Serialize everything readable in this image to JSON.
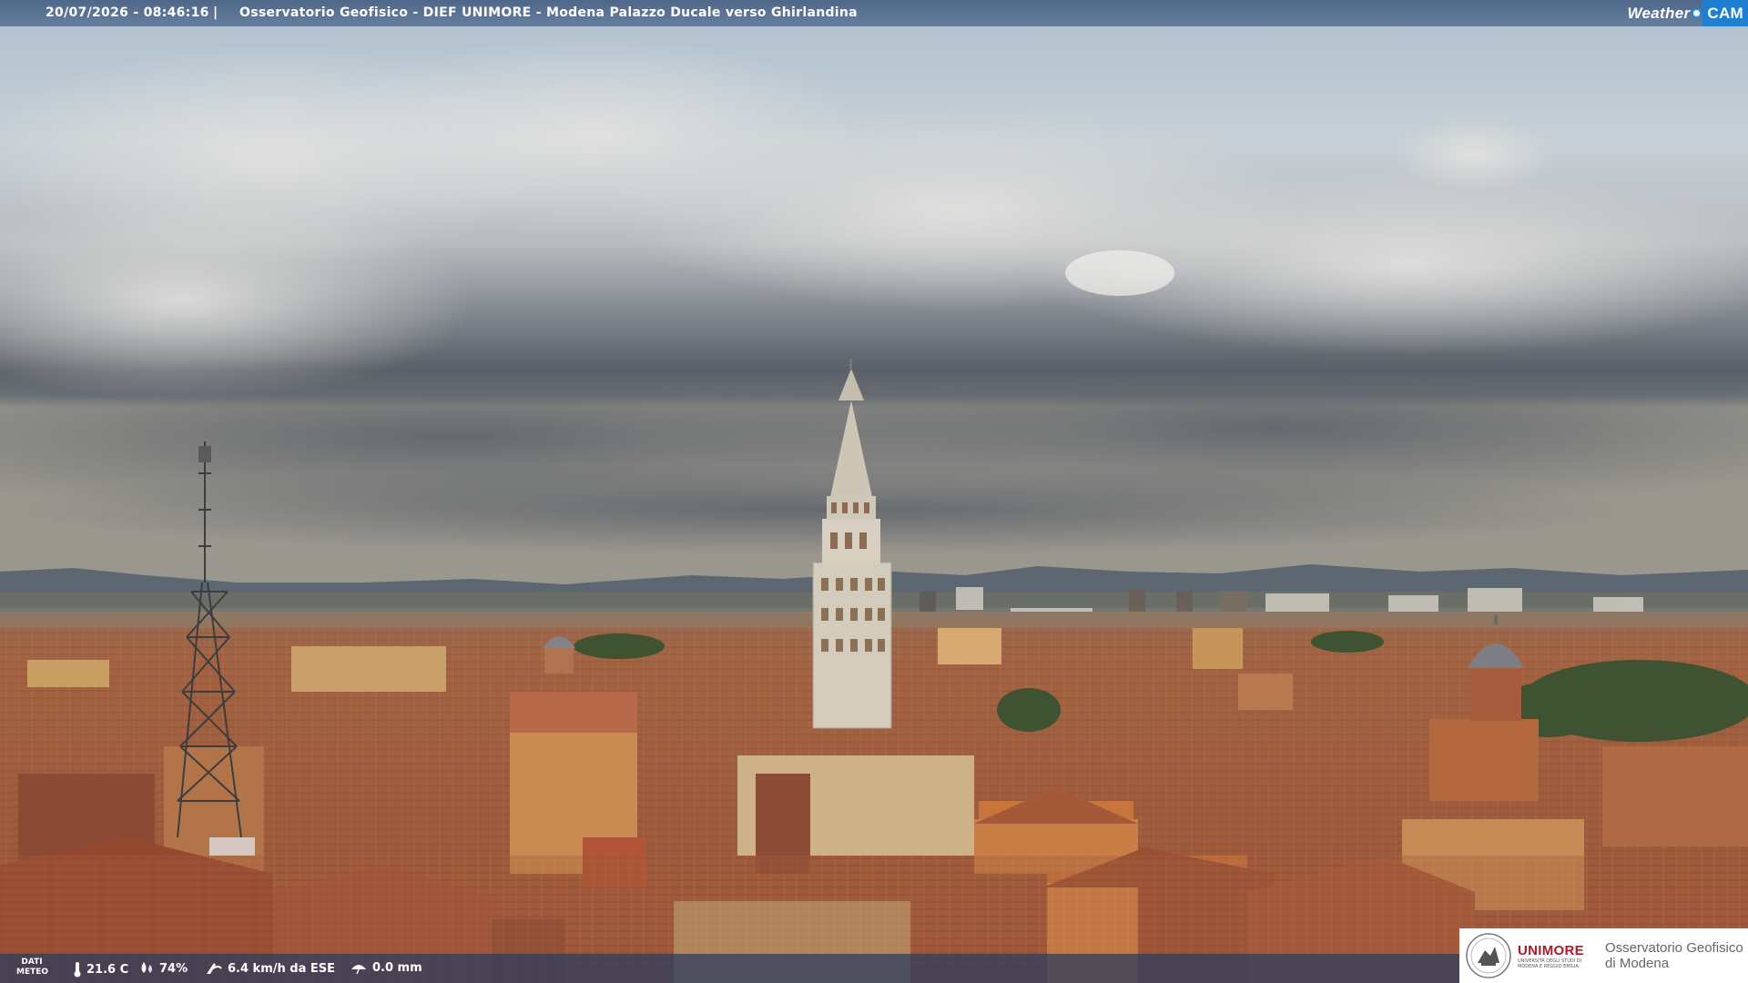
{
  "header": {
    "timestamp": "20/07/2026 - 08:46:16",
    "separator": "|",
    "location": "Osservatorio Geofisico - DIEF UNIMORE - Modena Palazzo Ducale verso Ghirlandina",
    "brand_left": "Weather",
    "brand_right": "CAM"
  },
  "meteo": {
    "label_line1": "DATI",
    "label_line2": "METEO",
    "temperature": "21.6 C",
    "humidity": "74%",
    "wind": "6.4 km/h da ESE",
    "rain": "0.0 mm"
  },
  "logo": {
    "brand": "UNIMORE",
    "sub_line1": "UNIVERSITÀ DEGLI STUDI DI",
    "sub_line2": "MODENA E REGGIO EMILIA",
    "observatory_line1": "Osservatorio Geofisico",
    "observatory_line2": "di Modena"
  },
  "colors": {
    "sky_top": "#a9bccc",
    "cloud_dark": "#4f555e",
    "roof": "#a0583a",
    "wall": "#c7894e",
    "tower_stone": "#d8d2c4",
    "bar_bg": "#3c5a86",
    "wc_accent": "#1f7fd0",
    "unimore_red": "#b0182a"
  }
}
